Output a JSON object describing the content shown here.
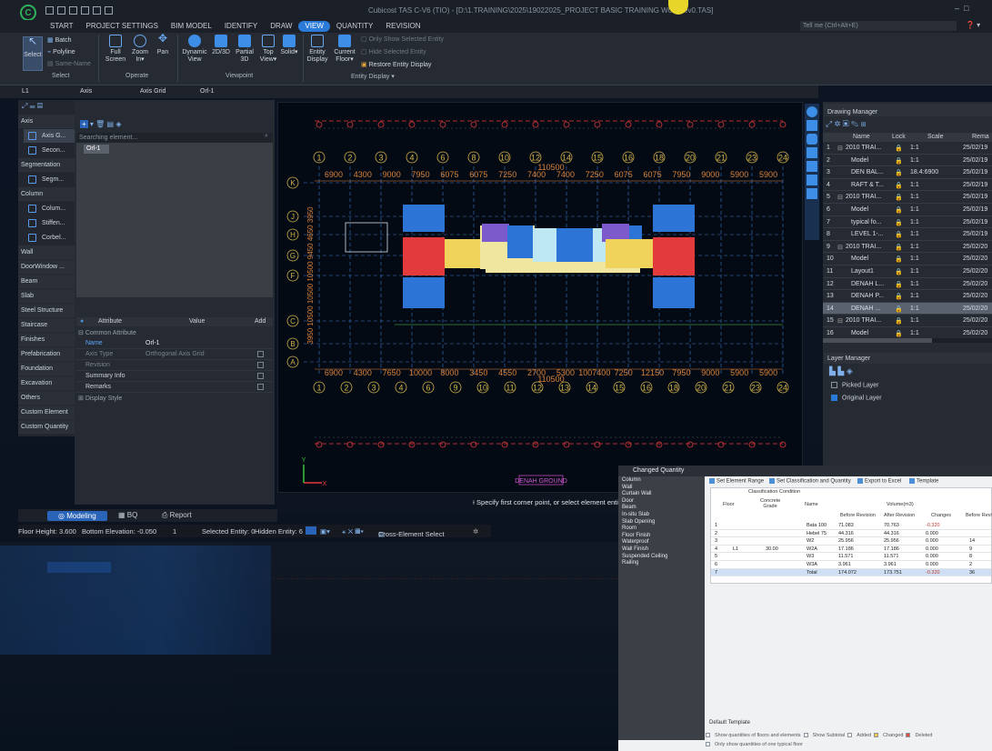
{
  "app": {
    "title": "Cubicost TAS C-V6 (TIO) - [D:\\1.TRAINING\\2025\\19022025_PROJECT BASIC TRAINING W06-Rev0.TAS]",
    "logo": "logo-icon"
  },
  "tabs": [
    "START",
    "PROJECT SETTINGS",
    "BIM MODEL",
    "IDENTIFY",
    "DRAW",
    "VIEW",
    "QUANTITY",
    "REVISION"
  ],
  "active_tab": "VIEW",
  "tell_me": "Tell me (Ctrl+Alt+E)",
  "ribbon": {
    "select": {
      "label": "Select",
      "batch": "Batch",
      "polyline": "Polyline",
      "same_name": "Same-Name",
      "group": "Select"
    },
    "operate": {
      "full_screen": "Full Screen",
      "zoom_in": "Zoom In",
      "pan": "Pan",
      "group": "Operate"
    },
    "viewpoint": {
      "dynamic_view": "Dynamic View",
      "view_2d3d": "2D/3D",
      "partial_3d": "Partial 3D",
      "top_view": "Top View",
      "solid": "Solid",
      "group": "Viewpoint"
    },
    "entity": {
      "entity_display": "Entity Display",
      "current_floor": "Current Floor",
      "only_show": "Only Show Selected Entity",
      "hide_selected": "Hide Selected Entity",
      "restore": "Restore Entity Display",
      "group": "Entity Display"
    }
  },
  "toolrow": {
    "floor": "L1",
    "axis": "Axis",
    "axis_grid": "Axis Grid",
    "orl": "Orl-1"
  },
  "left_panel": {
    "categories": [
      {
        "label": "Axis",
        "head": true
      },
      {
        "label": "Axis G...",
        "item": true,
        "sel": true
      },
      {
        "label": "Secon...",
        "item": true
      },
      {
        "label": "Segmentation",
        "head": true
      },
      {
        "label": "Segm...",
        "item": true
      },
      {
        "label": "Column",
        "head": true
      },
      {
        "label": "Colum...",
        "item": true
      },
      {
        "label": "Stiffen...",
        "item": true
      },
      {
        "label": "Corbel...",
        "item": true
      },
      {
        "label": "Wall",
        "head": true
      },
      {
        "label": "DoorWindow ...",
        "head": true
      },
      {
        "label": "Beam",
        "head": true
      },
      {
        "label": "Slab",
        "head": true
      },
      {
        "label": "Steel Structure",
        "head": true
      },
      {
        "label": "Staircase",
        "head": true
      },
      {
        "label": "Finishes",
        "head": true
      },
      {
        "label": "Prefabrication",
        "head": true
      },
      {
        "label": "Foundation",
        "head": true
      },
      {
        "label": "Excavation",
        "head": true
      },
      {
        "label": "Others",
        "head": true
      },
      {
        "label": "Custom Element",
        "head": true
      },
      {
        "label": "Custom Quantity",
        "head": true
      }
    ]
  },
  "mid_panel": {
    "search_placeholder": "Searching element...",
    "axis_item": "Orl-1",
    "attr_headers": [
      "Attribute",
      "Value",
      "Add"
    ],
    "common_attr": "Common Attribute",
    "rows": [
      {
        "attr": "Name",
        "value": "Orl-1",
        "highlight": true
      },
      {
        "attr": "Axis Type",
        "value": "Orthogonal Axis Grid",
        "dim": true
      },
      {
        "attr": "Revision",
        "value": "",
        "dim": true
      },
      {
        "attr": "Summary Info",
        "value": ""
      },
      {
        "attr": "Remarks",
        "value": ""
      }
    ],
    "display_style": "Display Style"
  },
  "canvas": {
    "top_axis": [
      "1",
      "2",
      "3",
      "4",
      "6",
      "8",
      "10",
      "12",
      "14",
      "15",
      "16",
      "18",
      "20",
      "21",
      "23",
      "24"
    ],
    "bottom_axis": [
      "1",
      "2",
      "3",
      "4",
      "6",
      "9",
      "10",
      "11",
      "12",
      "13",
      "14",
      "15",
      "16",
      "18",
      "20",
      "21",
      "23",
      "24"
    ],
    "left_axis": [
      "K",
      "J",
      "H",
      "G",
      "F",
      "C",
      "B",
      "A"
    ],
    "top_dims": [
      "6900",
      "4300",
      "9000",
      "7950",
      "6075",
      "6075",
      "7250",
      "7400",
      "7400",
      "7250",
      "6075",
      "6075",
      "7950",
      "9000",
      "5900",
      "5900"
    ],
    "bottom_dims": [
      "6900",
      "4300",
      "7650",
      "10000",
      "8000",
      "3450",
      "4550",
      "2700",
      "5300",
      "1007400",
      "7250",
      "12150",
      "7950",
      "9000",
      "5900",
      "5900"
    ],
    "total_top": "110500",
    "total_bottom": "110500",
    "left_dims": "3950 10500 10500 10500 9450 4650 3950",
    "denah_label": "DENAH GROUND"
  },
  "cmd_text": "Specify first corner point, or select element entity",
  "drawing_manager": {
    "title": "Drawing Manager",
    "headers": [
      "",
      "Name",
      "Lock",
      "Scale",
      "Rema"
    ],
    "rows": [
      {
        "n": "1",
        "name": "2010 TRAI...",
        "scale": "1:1",
        "rem": "25/02/19",
        "group": true
      },
      {
        "n": "2",
        "name": "Model",
        "scale": "1:1",
        "rem": "25/02/19"
      },
      {
        "n": "3",
        "name": "DEN BAL...",
        "scale": "18.4:6900",
        "rem": "25/02/19"
      },
      {
        "n": "4",
        "name": "RAFT & T...",
        "scale": "1:1",
        "rem": "25/02/19"
      },
      {
        "n": "5",
        "name": "2010 TRAI...",
        "scale": "1:1",
        "rem": "25/02/19",
        "group": true
      },
      {
        "n": "6",
        "name": "Model",
        "scale": "1:1",
        "rem": "25/02/19"
      },
      {
        "n": "7",
        "name": "typical fo...",
        "scale": "1:1",
        "rem": "25/02/19"
      },
      {
        "n": "8",
        "name": "LEVEL 1-...",
        "scale": "1:1",
        "rem": "25/02/19"
      },
      {
        "n": "9",
        "name": "2010 TRAI...",
        "scale": "1:1",
        "rem": "25/02/20",
        "group": true
      },
      {
        "n": "10",
        "name": "Model",
        "scale": "1:1",
        "rem": "25/02/20"
      },
      {
        "n": "11",
        "name": "Layout1",
        "scale": "1:1",
        "rem": "25/02/20"
      },
      {
        "n": "12",
        "name": "DENAH L...",
        "scale": "1:1",
        "rem": "25/02/20"
      },
      {
        "n": "13",
        "name": "DENAH P...",
        "scale": "1:1",
        "rem": "25/02/20"
      },
      {
        "n": "14",
        "name": "DENAH ...",
        "scale": "1:1",
        "rem": "25/02/20",
        "sel": true
      },
      {
        "n": "15",
        "name": "2010 TRAI...",
        "scale": "1:1",
        "rem": "25/02/20",
        "group": true
      },
      {
        "n": "16",
        "name": "Model",
        "scale": "1:1",
        "rem": "25/02/20"
      }
    ]
  },
  "layer_manager": {
    "title": "Layer Manager",
    "picked": "Picked Layer",
    "original": "Original Layer"
  },
  "bottom_tabs": [
    "Modeling",
    "BQ",
    "Report"
  ],
  "status": {
    "floor_height": "Floor Height: 3.600",
    "bottom_elev": "Bottom Elevation: -0.050",
    "num": "1",
    "selected": "Selected Entity: 0",
    "hidden": "Hidden Entity: 6",
    "cross": "Cross-Element Select"
  },
  "popup": {
    "title": "Changed Quantity",
    "list": [
      "Column",
      "Wall",
      "Curtain Wall",
      "Door",
      "Beam",
      "In-situ Slab",
      "Slab Opening",
      "Room",
      "Floor Finish",
      "Waterproof",
      "Wall Finish",
      "Suspended Ceiling",
      "Railing"
    ],
    "toolbar": [
      "Set Element Range",
      "Set Classification and Quantity",
      "Export to Excel",
      "Template"
    ],
    "class_cond": "Classification Condition",
    "headers": [
      "Floor",
      "Concrete Grade",
      "Name",
      "Volume(m3)"
    ],
    "sub_headers": [
      "Before Revision",
      "After Revision",
      "Changes",
      "Before Revi"
    ],
    "rows": [
      {
        "n": "1",
        "floor": "",
        "grade": "",
        "name": "Bata 100",
        "before": "71.083",
        "after": "70.763",
        "change": "-0.320",
        "rev": ""
      },
      {
        "n": "2",
        "floor": "",
        "grade": "",
        "name": "Hebel 75",
        "before": "44.316",
        "after": "44.316",
        "change": "0.000",
        "rev": ""
      },
      {
        "n": "3",
        "floor": "",
        "grade": "",
        "name": "W2",
        "before": "25.956",
        "after": "25.956",
        "change": "0.000",
        "rev": "14"
      },
      {
        "n": "4",
        "floor": "L1",
        "grade": "30.00",
        "name": "W2A",
        "before": "17.186",
        "after": "17.186",
        "change": "0.000",
        "rev": "9"
      },
      {
        "n": "5",
        "floor": "",
        "grade": "",
        "name": "W3",
        "before": "11.571",
        "after": "11.571",
        "change": "0.000",
        "rev": "8"
      },
      {
        "n": "6",
        "floor": "",
        "grade": "",
        "name": "W3A",
        "before": "3.961",
        "after": "3.961",
        "change": "0.000",
        "rev": "2"
      },
      {
        "n": "7",
        "floor": "",
        "grade": "",
        "name": "Total",
        "before": "174.072",
        "after": "173.751",
        "change": "-0.320",
        "rev": "36",
        "total": true
      }
    ],
    "default_template": "Default Template",
    "show_subtotal": "Show Subtotal",
    "added": "Added",
    "changed": "Changed",
    "deleted": "Deleted",
    "only_typical": "Only show quantities of one typical floor",
    "show_floors": "Show quantities of floors and elements"
  },
  "colors": {
    "accent": "#2a7ad8",
    "axis_red": "#e23b3b",
    "dim_orange": "#d9823a",
    "axis_circle": "#d4b34a",
    "grid_blue": "#3a78c8"
  }
}
